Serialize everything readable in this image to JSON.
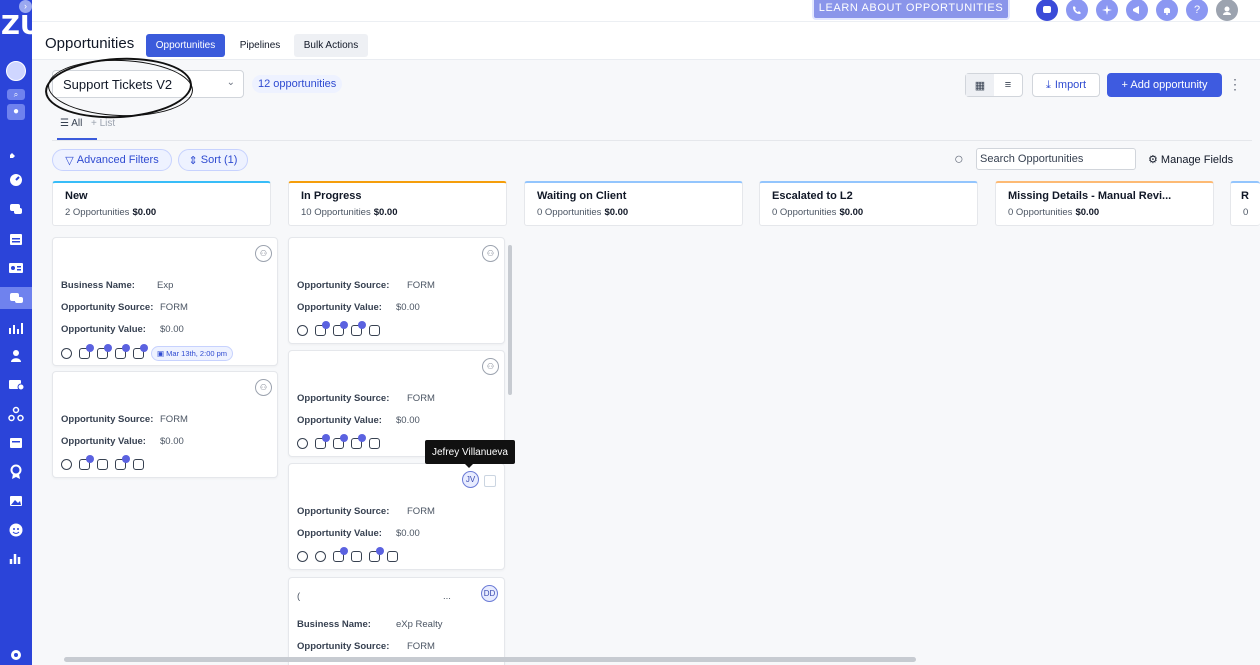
{
  "rail": {
    "logo": "ZU",
    "icons": [
      "avatar-circle",
      "search-icon",
      "user-icon",
      "rocket-icon",
      "dashboard-icon",
      "chat-icon",
      "calendar-icon",
      "contacts-icon",
      "conversations-icon",
      "opportunities-icon",
      "payments-icon",
      "mail-icon",
      "automation-icon",
      "sites-icon",
      "reputation-icon",
      "media-icon",
      "smiley-icon",
      "reporting-icon",
      "settings-icon"
    ]
  },
  "topbar": {
    "learn_label": "LEARN ABOUT OPPORTUNITIES",
    "icons": [
      "chat-icon",
      "phone-icon",
      "sparkle-icon",
      "megaphone-icon",
      "bell-icon",
      "help-icon",
      "profile-avatar"
    ]
  },
  "header": {
    "title": "Opportunities",
    "tabs": [
      {
        "label": "Opportunities",
        "active": true
      },
      {
        "label": "Pipelines",
        "active": false
      },
      {
        "label": "Bulk Actions",
        "active": false
      }
    ]
  },
  "controls": {
    "pipeline_select": "Support Tickets V2",
    "count_badge": "12 opportunities",
    "import_label": "Import",
    "add_label": "+ Add opportunity",
    "list_tab_all": "All",
    "list_tab_list": "+ List",
    "advanced_filters": "Advanced Filters",
    "sort": "Sort (1)",
    "search_placeholder": "Search Opportunities",
    "manage_fields": "Manage Fields"
  },
  "columns": [
    {
      "name": "New",
      "count": "2 Opportunities",
      "value": "$0.00",
      "accent": "#38bdf8"
    },
    {
      "name": "In Progress",
      "count": "10 Opportunities",
      "value": "$0.00",
      "accent": "#f59e0b"
    },
    {
      "name": "Waiting on Client",
      "count": "0 Opportunities",
      "value": "$0.00",
      "accent": "#93c5fd"
    },
    {
      "name": "Escalated to L2",
      "count": "0 Opportunities",
      "value": "$0.00",
      "accent": "#93c5fd"
    },
    {
      "name": "Missing Details - Manual Revi...",
      "count": "0 Opportunities",
      "value": "$0.00",
      "accent": "#fdba74"
    },
    {
      "name": "R",
      "count": "0",
      "value": "",
      "accent": "#93c5fd"
    }
  ],
  "cards": {
    "c1": {
      "business_label": "Business Name:",
      "business": "Exp",
      "source_label": "Opportunity Source:",
      "source": "FORM",
      "value_label": "Opportunity Value:",
      "value": "$0.00",
      "date": "Mar 13th, 2:00 pm"
    },
    "c2": {
      "source_label": "Opportunity Source:",
      "source": "FORM",
      "value_label": "Opportunity Value:",
      "value": "$0.00"
    },
    "c3": {
      "source_label": "Opportunity Source:",
      "source": "FORM",
      "value_label": "Opportunity Value:",
      "value": "$0.00"
    },
    "c4": {
      "source_label": "Opportunity Source:",
      "source": "FORM",
      "value_label": "Opportunity Value:",
      "value": "$0.00"
    },
    "c5": {
      "source_label": "Opportunity Source:",
      "source": "FORM",
      "value_label": "Opportunity Value:",
      "value": "$0.00",
      "initials": "JV"
    },
    "c6": {
      "title": "(",
      "dots": "...",
      "initials": "DD",
      "business_label": "Business Name:",
      "business": "eXp Realty",
      "source_label": "Opportunity Source:",
      "source": "FORM"
    }
  },
  "tooltip": "Jefrey Villanueva"
}
